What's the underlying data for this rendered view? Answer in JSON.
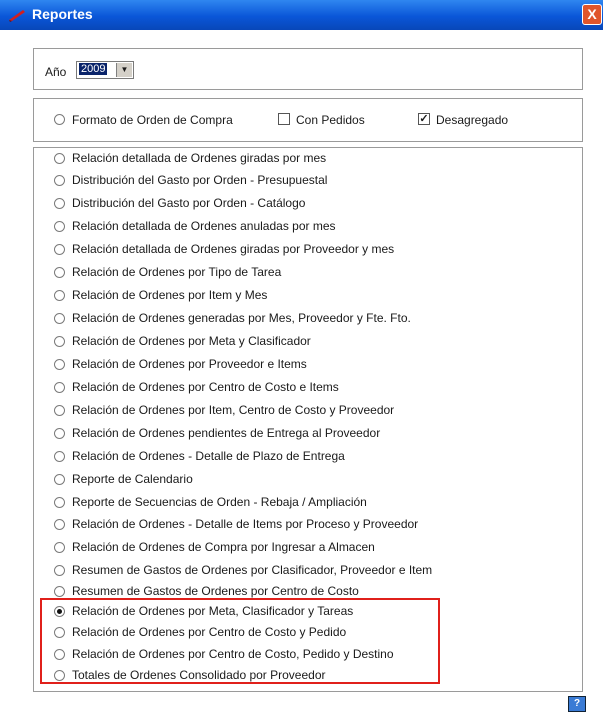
{
  "window": {
    "title": "Reportes",
    "close_label": "X"
  },
  "year_selector": {
    "label": "Año",
    "value": "2009"
  },
  "format_options": {
    "radio_label": "Formato de Orden de Compra",
    "con_pedidos": {
      "label": "Con Pedidos",
      "checked": false
    },
    "desagregado": {
      "label": "Desagregado",
      "checked": true,
      "mark": "✓"
    }
  },
  "reports": [
    {
      "label": "Relación detallada de Ordenes giradas por mes",
      "selected": false
    },
    {
      "label": "Distribución del Gasto por Orden - Presupuestal",
      "selected": false
    },
    {
      "label": "Distribución del Gasto por Orden - Catálogo",
      "selected": false
    },
    {
      "label": "Relación detallada de Ordenes anuladas por mes",
      "selected": false
    },
    {
      "label": "Relación detallada de Ordenes giradas por Proveedor y mes",
      "selected": false
    },
    {
      "label": "Relación de Ordenes por Tipo de Tarea",
      "selected": false
    },
    {
      "label": "Relación de Ordenes por Item y Mes",
      "selected": false
    },
    {
      "label": "Relación de Ordenes generadas por Mes, Proveedor y Fte. Fto.",
      "selected": false
    },
    {
      "label": "Relación de Ordenes por Meta y Clasificador",
      "selected": false
    },
    {
      "label": "Relación de Ordenes por Proveedor e Items",
      "selected": false
    },
    {
      "label": "Relación de Ordenes por Centro de Costo e Items",
      "selected": false
    },
    {
      "label": "Relación de Ordenes por Item, Centro de Costo y Proveedor",
      "selected": false
    },
    {
      "label": "Relación de Ordenes pendientes de Entrega al Proveedor",
      "selected": false
    },
    {
      "label": "Relación de Ordenes - Detalle de Plazo de Entrega",
      "selected": false
    },
    {
      "label": "Reporte de Calendario",
      "selected": false
    },
    {
      "label": "Reporte de Secuencias de Orden - Rebaja / Ampliación",
      "selected": false
    },
    {
      "label": "Relación de Ordenes - Detalle de Items por Proceso y Proveedor",
      "selected": false
    },
    {
      "label": "Relación de Ordenes de Compra por Ingresar a Almacen",
      "selected": false
    },
    {
      "label": "Resumen de Gastos de Ordenes por Clasificador, Proveedor e Item",
      "selected": false
    },
    {
      "label": "Resumen de Gastos de Ordenes por Centro de Costo",
      "selected": false
    },
    {
      "label": "Relación de Ordenes por Meta, Clasificador y Tareas",
      "selected": true
    },
    {
      "label": "Relación de Ordenes por Centro de Costo y Pedido",
      "selected": false
    },
    {
      "label": "Relación de Ordenes por Centro de Costo, Pedido y Destino",
      "selected": false
    },
    {
      "label": "Totales de Ordenes Consolidado por Proveedor",
      "selected": false
    }
  ],
  "highlight_color": "#e0201b",
  "help_button": {
    "icon": "help-book-icon"
  }
}
